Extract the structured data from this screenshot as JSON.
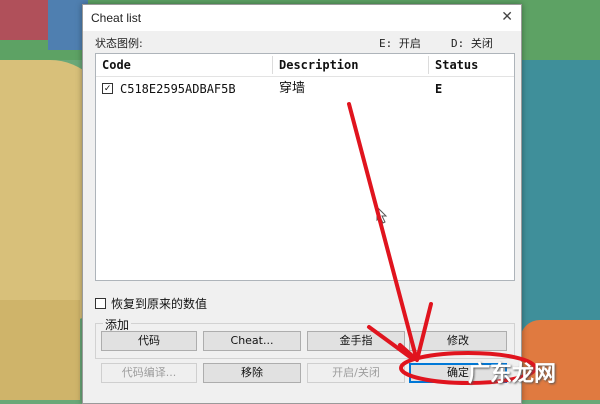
{
  "window": {
    "title": "Cheat list",
    "close_glyph": "✕"
  },
  "legend": {
    "label": "状态图例:",
    "enabled": "E: 开启",
    "disabled": "D: 关闭"
  },
  "table": {
    "headers": [
      "Code",
      "Description",
      "Status"
    ],
    "rows": [
      {
        "checked": true,
        "code": "C518E2595ADBAF5B",
        "description": "穿墙",
        "status": "E"
      }
    ]
  },
  "restore_checkbox": {
    "label": "恢复到原来的数值",
    "checked": false
  },
  "add_group": {
    "label": "添加",
    "buttons": [
      "代码",
      "Cheat...",
      "金手指",
      "修改"
    ]
  },
  "bottom_buttons": {
    "code_edit": "代码编译...",
    "remove": "移除",
    "toggle": "开启/关闭",
    "ok": "确定"
  },
  "watermark": "广东龙网",
  "annotation_color": "#e0141e",
  "icons": [
    "close-icon",
    "checkbox-checked-icon",
    "checkbox-empty-icon",
    "mouse-cursor-icon"
  ]
}
